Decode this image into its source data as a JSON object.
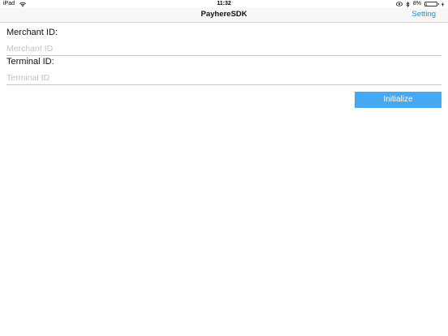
{
  "status_bar": {
    "device": "iPad",
    "time": "11:32",
    "battery_text": "8%",
    "battery_level": 0.08,
    "icons": [
      "wifi-icon",
      "eye-icon",
      "bluetooth-icon",
      "battery-icon",
      "charging-icon"
    ]
  },
  "nav": {
    "title": "PayhereSDK",
    "setting_label": "Setting"
  },
  "form": {
    "merchant_label": "Merchant ID:",
    "merchant_placeholder": "Merchant ID",
    "merchant_value": "",
    "terminal_label": "Terminal ID:",
    "terminal_placeholder": "Terminal ID",
    "terminal_value": "",
    "initialize_label": "Initialize"
  },
  "colors": {
    "accent": "#1f8ff2",
    "button": "#47a8f4",
    "battery_low": "#e53935"
  }
}
